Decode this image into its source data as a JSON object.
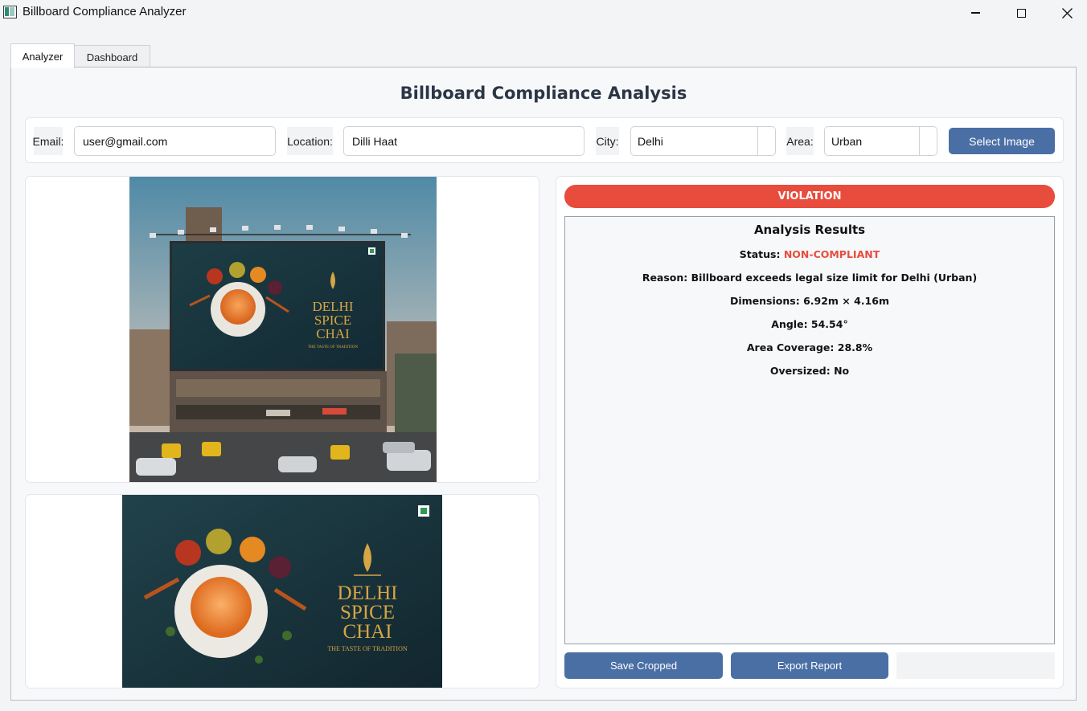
{
  "window": {
    "title": "Billboard Compliance Analyzer"
  },
  "tabs": [
    {
      "label": "Analyzer"
    },
    {
      "label": "Dashboard"
    }
  ],
  "heading": "Billboard Compliance Analysis",
  "form": {
    "email_label": "Email:",
    "email_value": "user@gmail.com",
    "location_label": "Location:",
    "location_value": "Dilli Haat",
    "city_label": "City:",
    "city_value": "Delhi",
    "area_label": "Area:",
    "area_value": "Urban",
    "select_image_label": "Select Image"
  },
  "billboard": {
    "brand_line1": "DELHI",
    "brand_line2": "SPICE",
    "brand_line3": "CHAI",
    "tagline": "THE TASTE OF TRADITION"
  },
  "results": {
    "banner": "VIOLATION",
    "title": "Analysis Results",
    "status_label": "Status:",
    "status_value": "NON-COMPLIANT",
    "reason": "Reason: Billboard exceeds legal size limit for Delhi (Urban)",
    "dimensions": "Dimensions: 6.92m × 4.16m",
    "angle": "Angle: 54.54°",
    "coverage": "Area Coverage: 28.8%",
    "oversized": "Oversized: No"
  },
  "actions": {
    "save_cropped": "Save Cropped",
    "export_report": "Export Report"
  },
  "colors": {
    "violation": "#e84c3d",
    "button": "#4a6fa5",
    "heading": "#2b3545"
  }
}
